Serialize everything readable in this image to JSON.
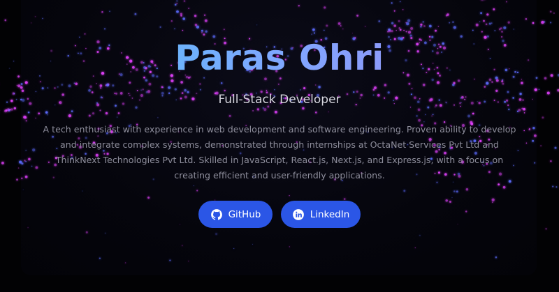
{
  "hero": {
    "name": "Paras Ohri",
    "role": "Full-Stack Developer",
    "description": "A tech enthusiast with experience in web development and software engineering. Proven ability to develop and integrate complex systems, demonstrated through internships at OctaNet Services Pvt Ltd and ThinkNext Technologies Pvt Ltd. Skilled in JavaScript, React.js, Next.js, and Express.js, with a focus on creating efficient and user-friendly applications."
  },
  "links": {
    "github": {
      "label": "GitHub",
      "icon": "github-icon"
    },
    "linkedin": {
      "label": "LinkedIn",
      "icon": "linkedin-icon"
    }
  },
  "colors": {
    "background": "#020204",
    "button": "#2b56e6",
    "title_gradient_start": "#4fc3f7",
    "title_gradient_end": "#a184f0",
    "particle_pink": "#e040fb",
    "particle_blue": "#5c6bff"
  }
}
